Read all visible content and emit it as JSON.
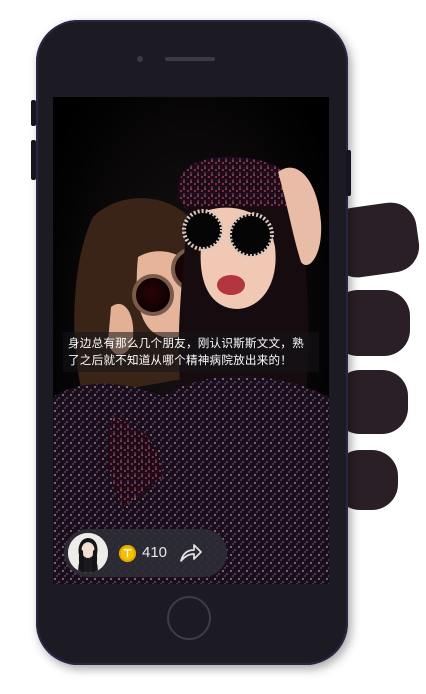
{
  "post": {
    "caption": "身边总有那么几个朋友，刚认识斯斯文文，熟了之后就不知道从哪个精神病院放出来的！",
    "coin_icon": "coin-icon",
    "coin_count": "410",
    "share_icon": "share-icon",
    "avatar": "user-avatar"
  },
  "colors": {
    "phone_body": "#1c1b24",
    "coin": "#f5c000",
    "pill": "#2d2d34"
  }
}
